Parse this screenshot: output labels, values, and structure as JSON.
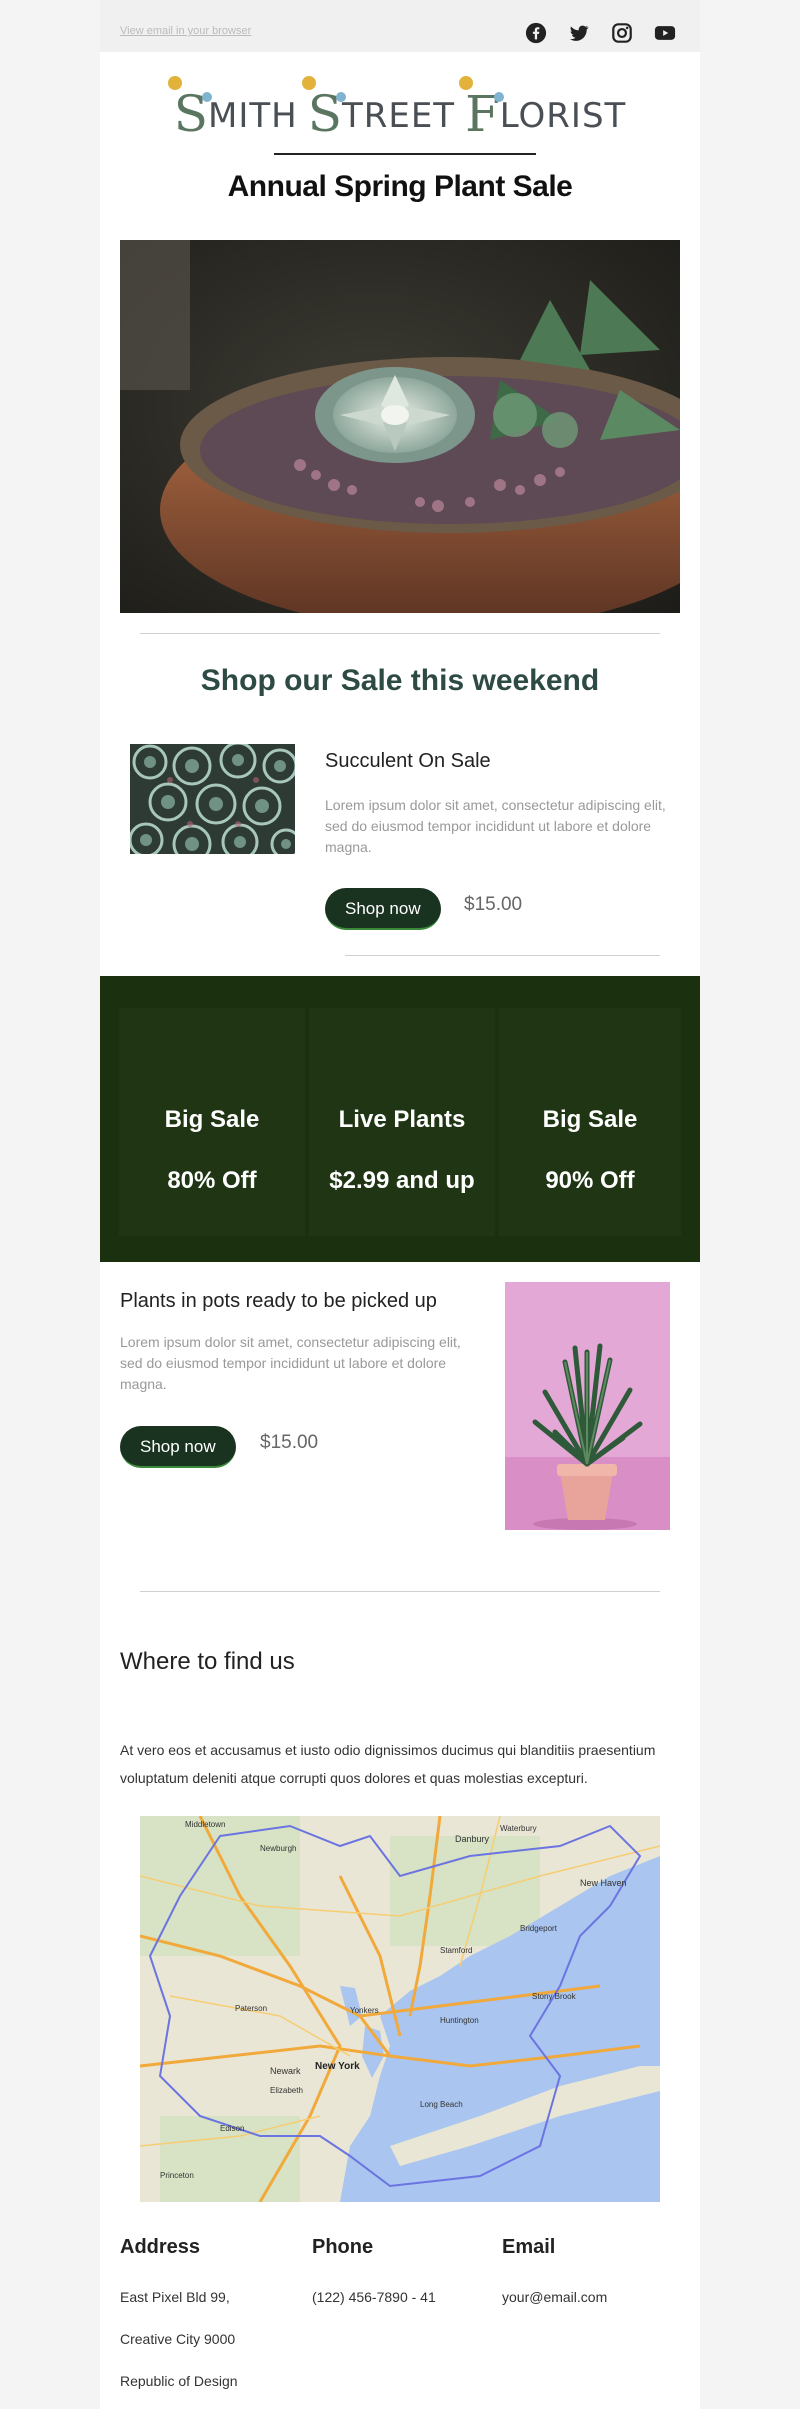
{
  "top_bar": {
    "view_in_browser": "View email in your browser",
    "social_icons": [
      "facebook-icon",
      "twitter-icon",
      "instagram-icon",
      "youtube-icon"
    ]
  },
  "logo": {
    "words": [
      {
        "initial": "S",
        "rest": "MITH"
      },
      {
        "initial": "S",
        "rest": "TREET"
      },
      {
        "initial": "F",
        "rest": "LORIST"
      }
    ]
  },
  "header": {
    "title": "Annual Spring Plant Sale"
  },
  "section": {
    "title": "Shop our Sale this weekend"
  },
  "product_1": {
    "name": "Succulent On Sale",
    "description": "Lorem ipsum dolor sit amet, consectetur adipiscing elit, sed do eiusmod tempor incididunt ut labore et dolore magna.",
    "button": "Shop now",
    "price": "$15.00"
  },
  "promo_cards": [
    {
      "title": "Big Sale",
      "subtitle": "80% Off"
    },
    {
      "title": "Live Plants",
      "subtitle": "$2.99 and up"
    },
    {
      "title": "Big Sale",
      "subtitle": "90% Off"
    }
  ],
  "product_2": {
    "name": "Plants in pots ready to be picked up",
    "description": "Lorem ipsum dolor sit amet, consectetur adipiscing elit, sed do eiusmod tempor incididunt ut labore et dolore magna.",
    "button": "Shop now",
    "price": "$15.00"
  },
  "find_us": {
    "title": "Where to find us",
    "text": "At vero eos et accusamus et iusto odio dignissimos ducimus qui blanditiis praesentium voluptatum deleniti atque corrupti quos dolores et quas molestias excepturi."
  },
  "map_labels": [
    "Middletown",
    "Danbury",
    "Newburgh",
    "New Haven",
    "Stamford",
    "Bridgeport",
    "Yonkers",
    "Paterson",
    "New York",
    "Newark",
    "Long Beach",
    "Elizabeth",
    "Edison",
    "Princeton",
    "Huntington",
    "Stony Brook",
    "Waterbury"
  ],
  "contact": {
    "address_label": "Address",
    "address_lines": [
      "East Pixel Bld 99,",
      "Creative City 9000",
      "Republic of Design"
    ],
    "phone_label": "Phone",
    "phone": "(122) 456-7890 - 41",
    "email_label": "Email",
    "email": "your@email.com"
  },
  "colors": {
    "accent_dark_green": "#1a3320",
    "band_green": "#1b300e",
    "title_teal": "#2e4a44"
  }
}
